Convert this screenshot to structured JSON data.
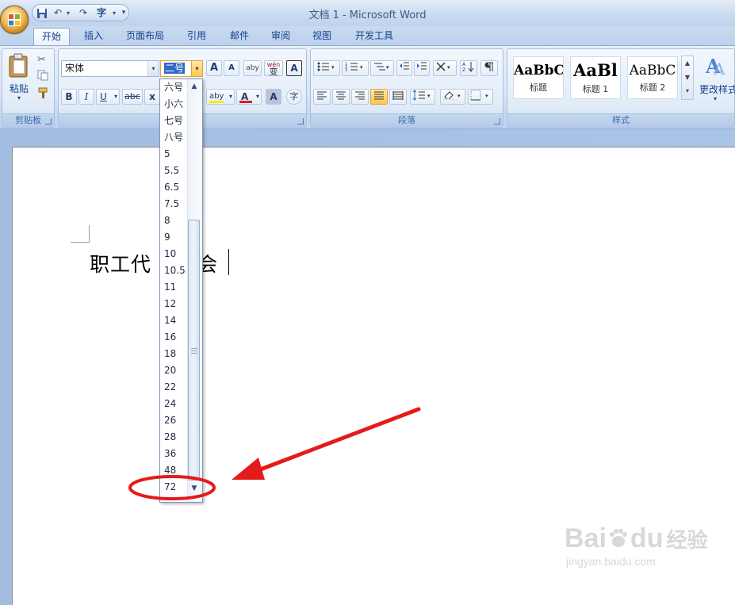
{
  "window": {
    "title": "文档 1 - Microsoft Word"
  },
  "quick_access": {
    "save": "save-icon",
    "undo": "↶",
    "redo": "↷",
    "spell": "字",
    "customize": "▾"
  },
  "tabs": [
    "开始",
    "插入",
    "页面布局",
    "引用",
    "邮件",
    "审阅",
    "视图",
    "开发工具"
  ],
  "active_tab": "开始",
  "clipboard": {
    "paste_label": "粘贴",
    "group_label": "剪贴板"
  },
  "font": {
    "font_name": "宋体",
    "font_size": "二号",
    "grow": "A",
    "shrink": "A",
    "clear_format": "aby",
    "phonetic": "wén",
    "phonetic_char": "变",
    "border_char": "A",
    "bold": "B",
    "italic": "I",
    "underline": "U",
    "strike": "abc",
    "subscript": "x",
    "highlight": "aby",
    "font_color": "A",
    "char_shading": "A",
    "enclose": "字"
  },
  "paragraph": {
    "group_label": "段落"
  },
  "styles": {
    "group_label": "样式",
    "items": [
      {
        "sample": "AaBbC",
        "name": "标题"
      },
      {
        "sample": "AaBl",
        "name": "标题 1"
      },
      {
        "sample": "AaBbC",
        "name": "标题 2"
      }
    ],
    "change_styles": "更改样式"
  },
  "font_size_dropdown": {
    "options": [
      "六号",
      "小六",
      "七号",
      "八号",
      "5",
      "5.5",
      "6.5",
      "7.5",
      "8",
      "9",
      "10",
      "10.5",
      "11",
      "12",
      "14",
      "16",
      "18",
      "20",
      "22",
      "24",
      "26",
      "28",
      "36",
      "48",
      "72"
    ]
  },
  "document": {
    "text_before": "职工代",
    "text_after": "会"
  },
  "watermark": {
    "brand": "Bai",
    "brand2": "du",
    "jingyan": "经验",
    "url": "jingyan.baidu.com"
  },
  "colors": {
    "annotation": "#e41b1b",
    "font_color_bar": "#e21d1d",
    "highlight_bar": "#ffe600"
  }
}
